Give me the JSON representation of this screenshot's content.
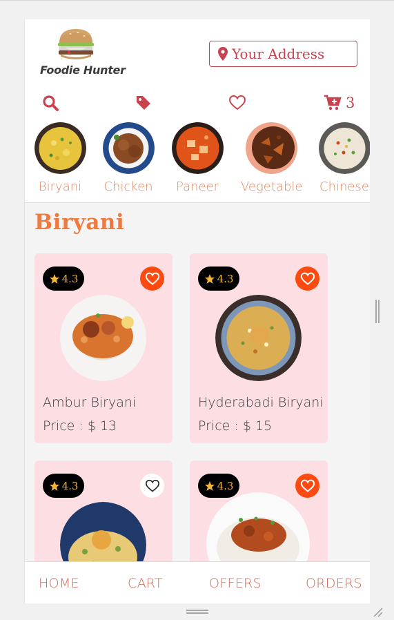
{
  "brand": {
    "name": "Foodie Hunter"
  },
  "header": {
    "address_label": "Your Address",
    "cart_count": "3"
  },
  "icons": {
    "search": "search-icon",
    "offers": "tag-icon",
    "wishlist": "heart-icon",
    "cart": "cart-plus-icon",
    "location": "map-marker-icon"
  },
  "categories": [
    {
      "label": "Biryani"
    },
    {
      "label": "Chicken"
    },
    {
      "label": "Paneer"
    },
    {
      "label": "Vegetable"
    },
    {
      "label": "Chinese"
    }
  ],
  "section": {
    "title": "Biryani"
  },
  "items": [
    {
      "name": "Ambur Biryani",
      "price": "Price : $ 13",
      "rating": "4.3",
      "favorited": true
    },
    {
      "name": "Hyderabadi Biryani",
      "price": "Price : $ 15",
      "rating": "4.3",
      "favorited": true
    },
    {
      "name": "",
      "price": "",
      "rating": "4.3",
      "favorited": false
    },
    {
      "name": "",
      "price": "",
      "rating": "4.3",
      "favorited": true
    }
  ],
  "nav": {
    "home": "HOME",
    "cart": "CART",
    "offers": "OFFERS",
    "orders": "ORDERS"
  },
  "colors": {
    "accent": "#c9434f",
    "orange": "#f07a3e",
    "card_bg": "#fddfe3",
    "fav_on": "#fd4a10",
    "rating_star": "#f0b63a"
  }
}
